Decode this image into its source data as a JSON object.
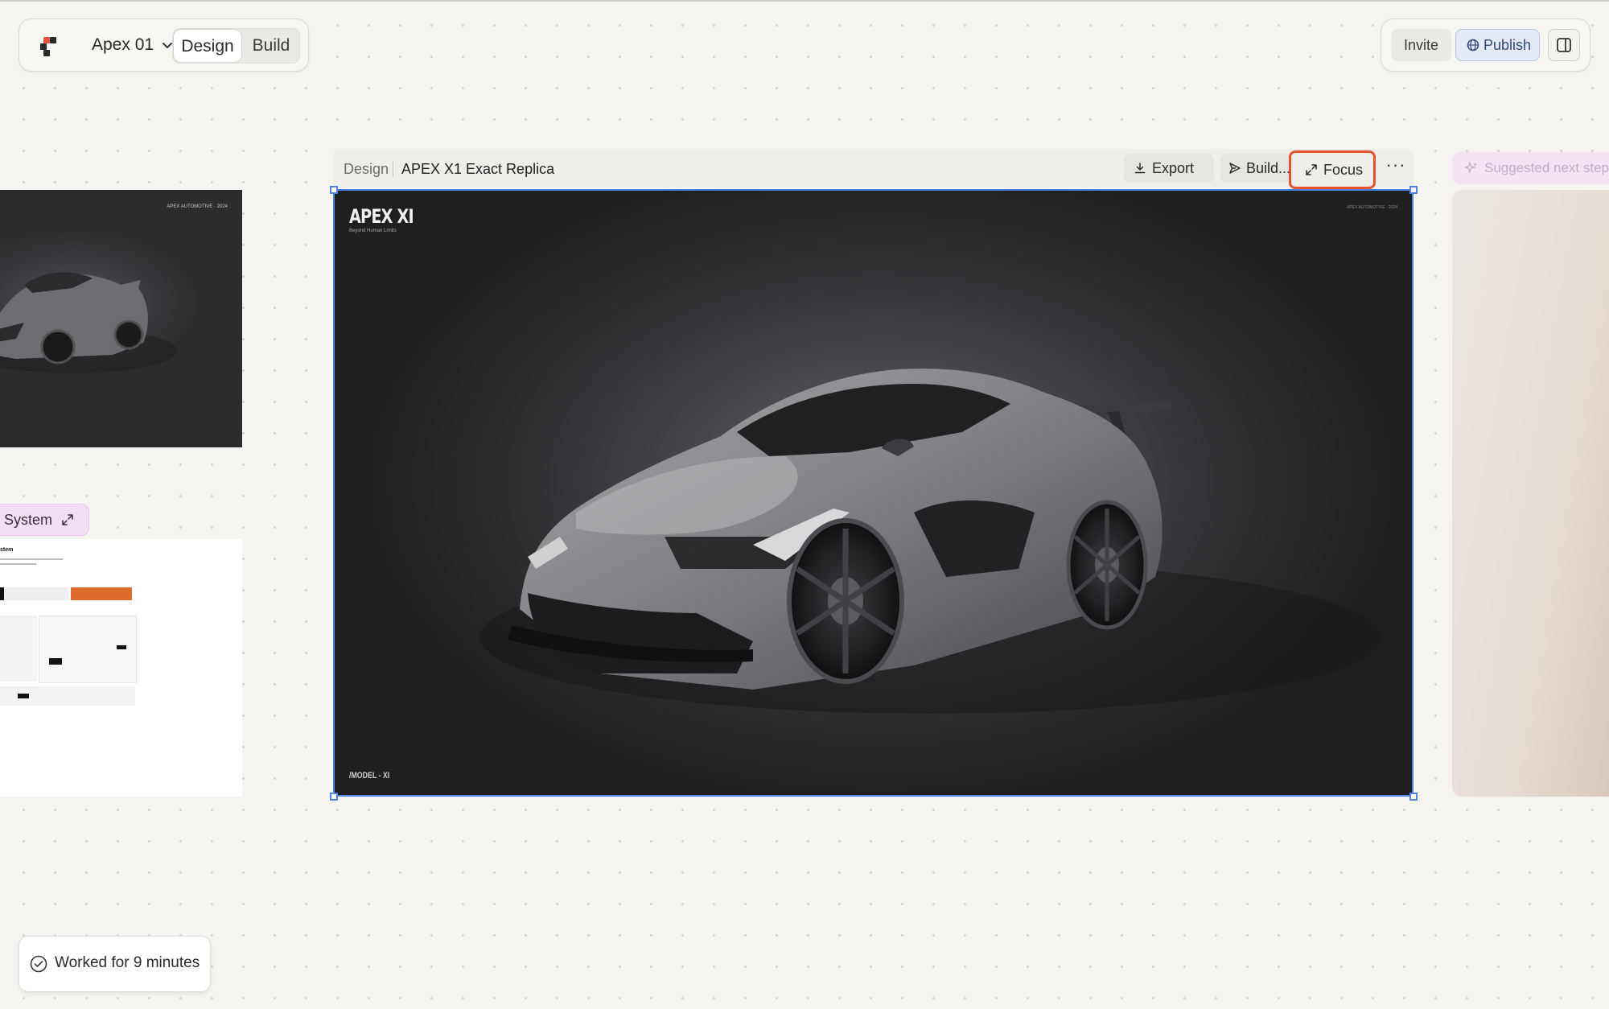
{
  "project": {
    "name": "Apex 01",
    "modes": [
      "Design",
      "Build"
    ],
    "active_mode": "Design"
  },
  "toolbar": {
    "invite_label": "Invite",
    "publish_label": "Publish"
  },
  "frame": {
    "breadcrumb": "Design",
    "title": "APEX X1 Exact Replica",
    "export_label": "Export",
    "build_label": "Build...",
    "focus_label": "Focus",
    "more_label": "···",
    "brand": "APEX XI",
    "tagline": "Beyond Human Limits",
    "model_label": "/MODEL - XI",
    "corner_text": "APEX AUTOMOTIVE · 2024"
  },
  "left_frames": {
    "brand_small": "APEX AUTOMOTIVE · 2024",
    "system_label": "System",
    "doc_title": "stem"
  },
  "suggested": {
    "label": "Suggested next step"
  },
  "status": {
    "worked_label": "Worked for 9 minutes"
  },
  "colors": {
    "selection": "#4f84e6",
    "focus_highlight": "#e4542c",
    "publish_bg": "#e4eaf5",
    "system_tag_bg": "#f4def5"
  },
  "icons": [
    "logo-icon",
    "chevron-down-icon",
    "globe-icon",
    "sidebar-toggle-icon",
    "download-icon",
    "send-icon",
    "expand-icon",
    "sparkle-icon",
    "check-circle-icon"
  ]
}
